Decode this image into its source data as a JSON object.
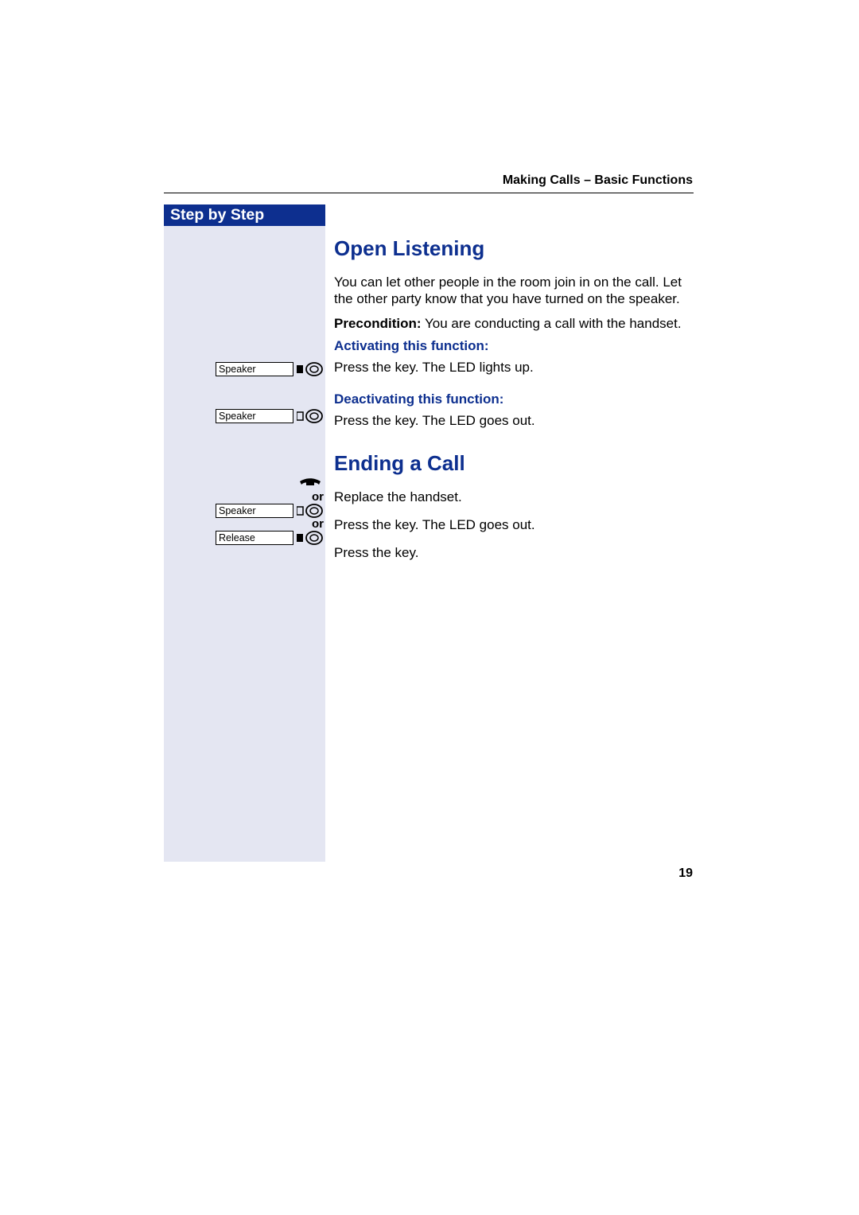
{
  "header": {
    "section_title": "Making Calls – Basic Functions"
  },
  "sidebar": {
    "title": "Step by Step"
  },
  "steps": {
    "key_speaker": "Speaker",
    "key_release": "Release",
    "or_label": "or"
  },
  "content": {
    "heading1": "Open Listening",
    "para1": "You can let other people in the room join in on the call. Let the other party know that you have turned on the speaker.",
    "precond_label": "Precondition:",
    "precond_text": " You are conducting a call with the hand­set.",
    "activating_h": "Activating this function:",
    "activating_text": "Press the key. The LED lights up.",
    "deactivating_h": "Deactivating this function:",
    "deactivating_text": "Press the key. The LED goes out.",
    "heading2": "Ending a Call",
    "end_step1": "Replace the handset.",
    "end_step2": "Press the key. The LED goes out.",
    "end_step3": "Press the key."
  },
  "page_number": "19"
}
